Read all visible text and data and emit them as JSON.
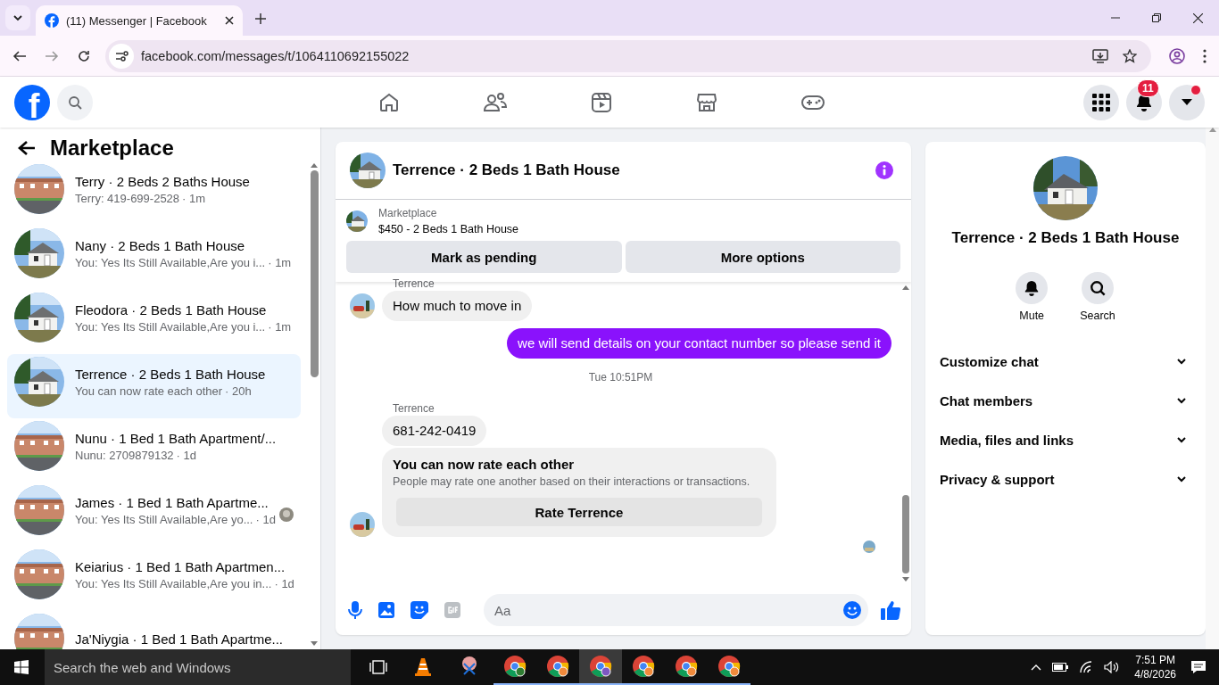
{
  "browser": {
    "tab_title": "(11) Messenger | Facebook",
    "url": "facebook.com/messages/t/1064110692155022"
  },
  "header": {
    "logo": "f",
    "notifications_badge": "11",
    "account_dot": true
  },
  "sidebar": {
    "title": "Marketplace",
    "conversations": [
      {
        "name": "Terry · 2 Beds 2 Baths House",
        "preview": "Terry: 419-699-2528",
        "time": "· 1m",
        "selected": false,
        "read_receipt": false
      },
      {
        "name": "Nany · 2 Beds 1 Bath House",
        "preview": "You: Yes Its Still Available,Are you i...",
        "time": "· 1m",
        "selected": false,
        "read_receipt": false
      },
      {
        "name": "Fleodora · 2 Beds 1 Bath House",
        "preview": "You: Yes Its Still Available,Are you i...",
        "time": "· 1m",
        "selected": false,
        "read_receipt": false
      },
      {
        "name": "Terrence · 2 Beds 1 Bath House",
        "preview": "You can now rate each other",
        "time": "· 20h",
        "selected": true,
        "read_receipt": false
      },
      {
        "name": "Nunu · 1 Bed 1 Bath Apartment/...",
        "preview": "Nunu: 2709879132",
        "time": "· 1d",
        "selected": false,
        "read_receipt": false
      },
      {
        "name": "James · 1 Bed 1 Bath Apartme...",
        "preview": "You: Yes Its Still Available,Are yo...",
        "time": "· 1d",
        "selected": false,
        "read_receipt": true
      },
      {
        "name": "Keiarius · 1 Bed 1 Bath Apartmen...",
        "preview": "You: Yes Its Still Available,Are you in...",
        "time": "· 1d",
        "selected": false,
        "read_receipt": false
      },
      {
        "name": "Ja'Niygia · 1 Bed 1 Bath Apartme...",
        "selected": false,
        "read_receipt": false
      }
    ]
  },
  "chat": {
    "title": "Terrence · 2 Beds 1 Bath House",
    "listing": {
      "label": "Marketplace",
      "title": "$450 - 2 Beds 1 Bath House",
      "buttons": [
        "Mark as pending",
        "More options"
      ]
    },
    "messages": [
      {
        "kind": "sender",
        "text": "Terrence"
      },
      {
        "kind": "incoming",
        "text": "How much to move in",
        "avatar": true
      },
      {
        "kind": "outgoing",
        "text": "we will send details on your contact number so please send it"
      },
      {
        "kind": "timestamp",
        "text": "Tue 10:51PM"
      },
      {
        "kind": "sender",
        "text": "Terrence"
      },
      {
        "kind": "incoming",
        "text": "681-242-0419",
        "avatar": false
      },
      {
        "kind": "rating",
        "title": "You can now rate each other",
        "text": "People may rate one another based on their interactions or transactions.",
        "button": "Rate Terrence",
        "avatar": true
      },
      {
        "kind": "seen"
      }
    ],
    "composer": {
      "placeholder": "Aa"
    }
  },
  "details": {
    "title": "Terrence · 2 Beds 1 Bath House",
    "actions": [
      {
        "kind": "mute",
        "label": "Mute"
      },
      {
        "kind": "search",
        "label": "Search"
      }
    ],
    "sections": [
      "Customize chat",
      "Chat members",
      "Media, files and links",
      "Privacy & support"
    ]
  },
  "taskbar": {
    "search_placeholder": "Search the web and Windows",
    "time": "7:51 PM",
    "date": "4/8/2026"
  }
}
